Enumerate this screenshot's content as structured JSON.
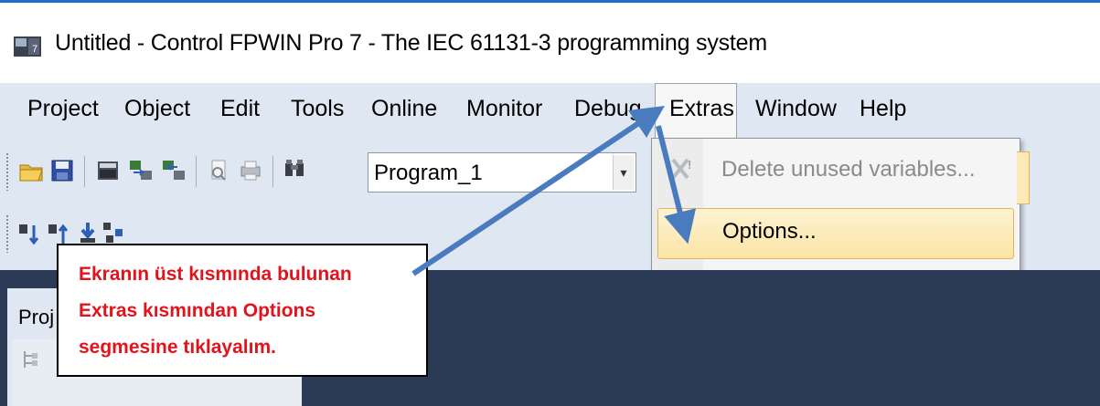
{
  "window": {
    "title": "Untitled - Control FPWIN Pro 7 - The IEC 61131-3 programming system"
  },
  "menubar": {
    "items": [
      {
        "label": "Project"
      },
      {
        "label": "Object"
      },
      {
        "label": "Edit"
      },
      {
        "label": "Tools"
      },
      {
        "label": "Online"
      },
      {
        "label": "Monitor"
      },
      {
        "label": "Debug"
      },
      {
        "label": "Extras"
      },
      {
        "label": "Window"
      },
      {
        "label": "Help"
      }
    ],
    "active": "Extras"
  },
  "toolbar": {
    "program_combo": {
      "value": "Program_1"
    }
  },
  "extras_menu": {
    "items": [
      {
        "label": "Delete unused variables...",
        "enabled": false,
        "icon": "delete-variables-icon"
      },
      {
        "label": "Options...",
        "enabled": true,
        "highlighted": true
      }
    ]
  },
  "left_panel": {
    "title": "Proj"
  },
  "callout": {
    "lines": [
      "Ekranın üst kısmında bulunan",
      "Extras kısmından Options",
      "segmesine tıklayalım."
    ]
  },
  "colors": {
    "title_accent": "#1e6fc8",
    "menubar_bg": "#dfe7f2",
    "highlight_bg": "#fbe4a6",
    "highlight_border": "#e2b45a",
    "dark_workspace": "#2b3a55",
    "callout_text": "#e3131b",
    "arrow": "#4a7bbf"
  }
}
